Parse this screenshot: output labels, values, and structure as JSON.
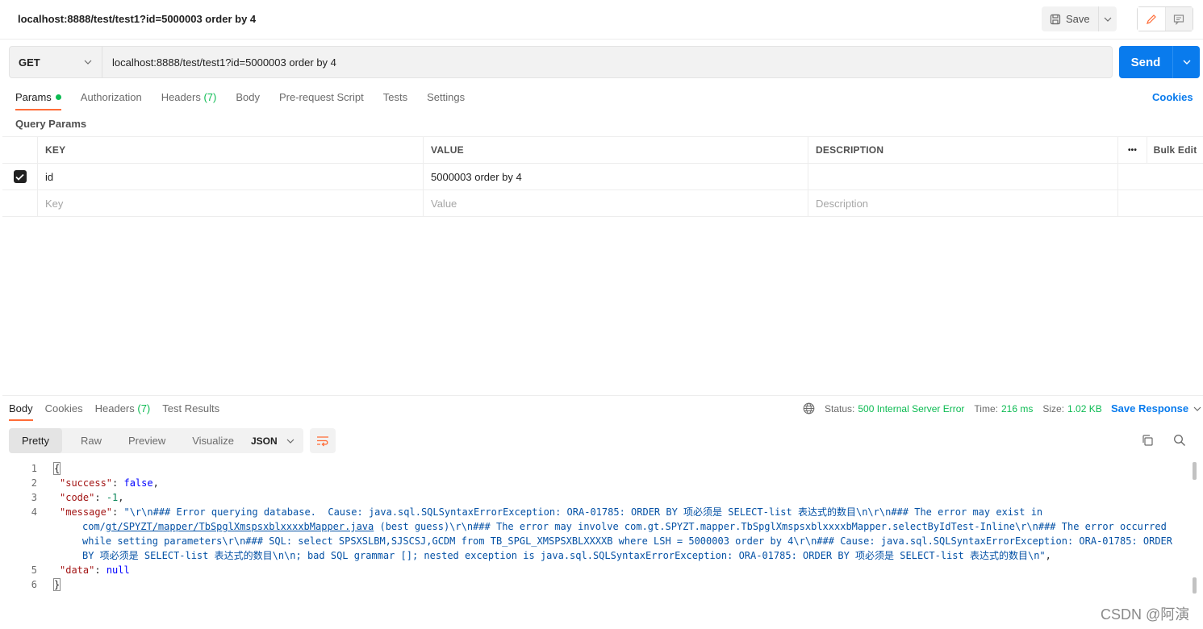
{
  "header": {
    "title": "localhost:8888/test/test1?id=5000003 order by 4",
    "save_label": "Save"
  },
  "request": {
    "method": "GET",
    "url": "localhost:8888/test/test1?id=5000003 order by 4",
    "send_label": "Send"
  },
  "tabs": {
    "params": "Params",
    "authorization": "Authorization",
    "headers": "Headers",
    "headers_count": "(7)",
    "body": "Body",
    "prerequest": "Pre-request Script",
    "tests": "Tests",
    "settings": "Settings",
    "cookies": "Cookies"
  },
  "query_params": {
    "section_label": "Query Params",
    "columns": {
      "key": "KEY",
      "value": "VALUE",
      "description": "DESCRIPTION",
      "more": "•••",
      "bulk": "Bulk Edit"
    },
    "rows": [
      {
        "checked": true,
        "key": "id",
        "value": "5000003 order by 4",
        "description": ""
      }
    ],
    "placeholders": {
      "key": "Key",
      "value": "Value",
      "description": "Description"
    }
  },
  "response": {
    "tabs": {
      "body": "Body",
      "cookies": "Cookies",
      "headers": "Headers",
      "headers_count": "(7)",
      "test_results": "Test Results"
    },
    "status_label": "Status:",
    "status_value": "500 Internal Server Error",
    "time_label": "Time:",
    "time_value": "216 ms",
    "size_label": "Size:",
    "size_value": "1.02 KB",
    "save_response": "Save Response",
    "views": [
      "Pretty",
      "Raw",
      "Preview",
      "Visualize"
    ],
    "format": "JSON",
    "line_numbers": [
      "1",
      "2",
      "3",
      "4",
      "5",
      "6"
    ],
    "json": {
      "open": "{",
      "close": "}",
      "success_key": "\"success\"",
      "success_val": "false",
      "code_key": "\"code\"",
      "code_val": "-1",
      "message_key": "\"message\"",
      "message_part1": "\"\\r\\n### Error querying database.  Cause: java.sql.SQLSyntaxErrorException: ORA-01785: ORDER BY 项必须是 SELECT-list 表达式的数目\\n\\r\\n### The error may exist in com/",
      "message_link1": "gt/SPYZT/mapper/",
      "message_link2": "TbSpglXmspsxblxxxxbMapper.java",
      "message_part2": " (best guess)\\r\\n### The error may involve com.gt.SPYZT.mapper.TbSpglXmspsxblxxxxbMapper.selectByIdTest-Inline\\r\\n### The error occurred while setting parameters\\r\\n### SQL: select SPSXSLBM,SJSCSJ,GCDM from TB_SPGL_XMSPSXBLXXXXB where LSH = 5000003 order by 4\\r\\n### Cause: java.sql.SQLSyntaxErrorException: ORA-01785: ORDER BY 项必须是 SELECT-list 表达式的数目\\n\\n; bad SQL grammar []; nested exception is java.sql.SQLSyntaxErrorException: ORA-01785: ORDER BY 项必须是 SELECT-list 表达式的数目\\n\"",
      "data_key": "\"data\"",
      "data_val": "null"
    }
  },
  "watermark": "CSDN @阿演",
  "colors": {
    "accent_orange": "#ff6c37",
    "send_blue": "#097bed",
    "status_green": "#0cbb52"
  }
}
